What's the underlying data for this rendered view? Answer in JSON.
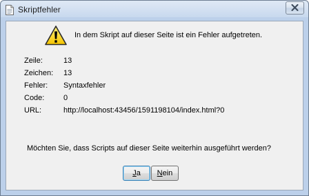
{
  "window": {
    "title": "Skriptfehler"
  },
  "message": "In dem Skript auf dieser Seite ist ein Fehler aufgetreten.",
  "details": [
    {
      "label": "Zeile:",
      "value": "13"
    },
    {
      "label": "Zeichen:",
      "value": "13"
    },
    {
      "label": "Fehler:",
      "value": "Syntaxfehler"
    },
    {
      "label": "Code:",
      "value": "0"
    },
    {
      "label": "URL:",
      "value": "http://localhost:43456/1591198104/index.html?0"
    }
  ],
  "question": "Möchten Sie, dass Scripts auf dieser Seite weiterhin ausgeführt werden?",
  "buttons": {
    "yes": {
      "mnemonic": "J",
      "rest": "a"
    },
    "no": {
      "mnemonic": "N",
      "rest": "ein"
    }
  },
  "icons": {
    "title": "document-icon",
    "warning": "warning-icon",
    "close": "close-icon"
  }
}
